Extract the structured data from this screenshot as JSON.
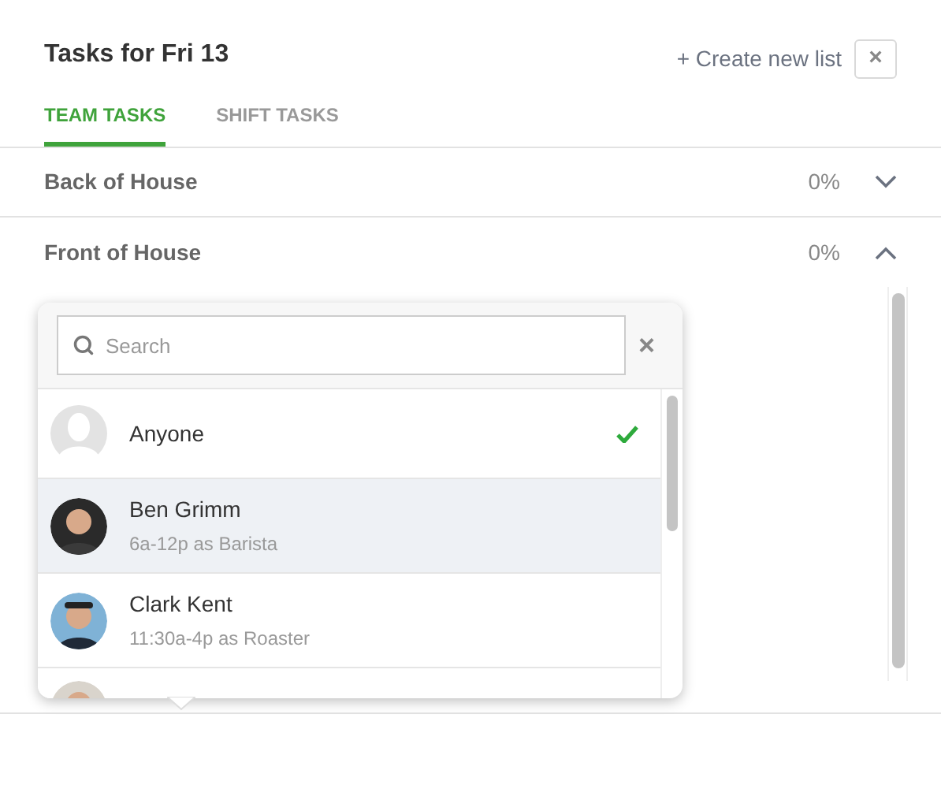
{
  "header": {
    "title": "Tasks for Fri 13",
    "create_button": "+ Create new list",
    "close_button": "×"
  },
  "tabs": [
    {
      "label": "TEAM TASKS",
      "selected": true
    },
    {
      "label": "SHIFT TASKS",
      "selected": false
    }
  ],
  "sections": [
    {
      "name": "Back of House",
      "percent": "0%",
      "expanded": false
    },
    {
      "name": "Front of House",
      "percent": "0%",
      "expanded": true
    }
  ],
  "assignee_popup": {
    "search": {
      "placeholder": "Search"
    },
    "clear_button": "×",
    "people": [
      {
        "kind": "anyone",
        "name": "Anyone",
        "checked": true,
        "highlighted": false
      },
      {
        "kind": "person",
        "name": "Ben Grimm",
        "shift": "6a-12p as Barista",
        "checked": false,
        "highlighted": true
      },
      {
        "kind": "person",
        "name": "Clark Kent",
        "shift": "11:30a-4p as Roaster",
        "checked": false,
        "highlighted": false
      },
      {
        "kind": "person",
        "checked": false,
        "highlighted": false
      }
    ]
  }
}
